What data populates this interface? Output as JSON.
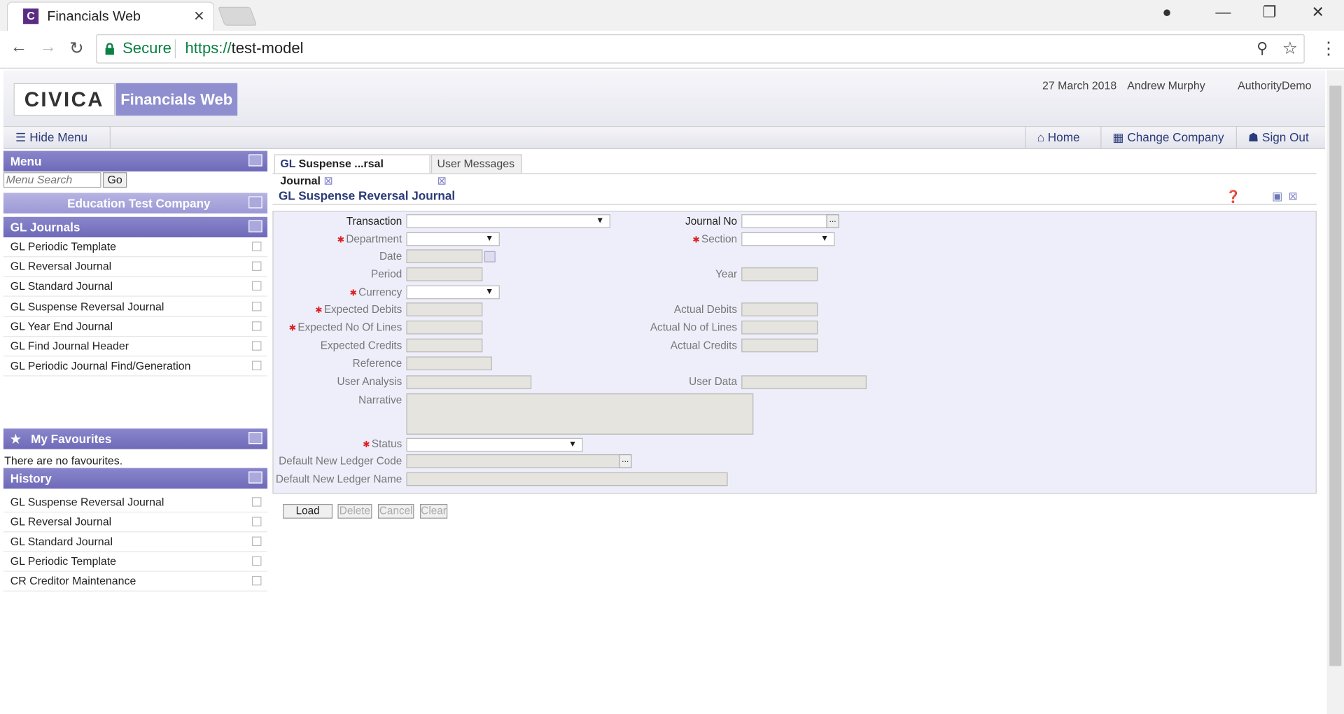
{
  "browser": {
    "tab_title": "Financials Web",
    "secure_label": "Secure",
    "url_scheme": "https://",
    "url_host": "test-model"
  },
  "app": {
    "logo": "CIVICA",
    "product": "Financials Web",
    "date": "27 March 2018",
    "user": "Andrew Murphy",
    "authority": "AuthorityDemo"
  },
  "toolbar": {
    "hide_menu": "Hide Menu",
    "home": "Home",
    "change_company": "Change Company",
    "sign_out": "Sign Out"
  },
  "menu": {
    "title": "Menu",
    "search_placeholder": "Menu Search",
    "go": "Go",
    "company": "Education Test Company",
    "section": "GL Journals",
    "items": [
      "GL Periodic Template",
      "GL Reversal Journal",
      "GL Standard Journal",
      "GL Suspense Reversal Journal",
      "GL Year End Journal",
      "GL Find Journal Header",
      "GL Periodic Journal Find/Generation"
    ]
  },
  "favourites": {
    "title": "My Favourites",
    "empty": "There are no favourites."
  },
  "history": {
    "title": "History",
    "items": [
      "GL Suspense Reversal Journal",
      "GL Reversal Journal",
      "GL Standard Journal",
      "GL Periodic Template",
      "CR Creditor Maintenance"
    ]
  },
  "tabs": {
    "active_prefix": "GL",
    "active_rest": " Suspense ...rsal Journal",
    "inactive": "User Messages"
  },
  "form": {
    "title": "GL Suspense Reversal Journal",
    "labels": {
      "transaction": "Transaction",
      "journal_no": "Journal No",
      "department": "Department",
      "section": "Section",
      "date": "Date",
      "period": "Period",
      "year": "Year",
      "currency": "Currency",
      "expected_debits": "Expected Debits",
      "actual_debits": "Actual Debits",
      "expected_lines": "Expected No Of Lines",
      "actual_lines": "Actual No of Lines",
      "expected_credits": "Expected Credits",
      "actual_credits": "Actual Credits",
      "reference": "Reference",
      "user_analysis": "User Analysis",
      "user_data": "User Data",
      "narrative": "Narrative",
      "status": "Status",
      "default_ledger_code": "Default New Ledger Code",
      "default_ledger_name": "Default New Ledger Name"
    },
    "lookup": "...",
    "dropdown": "▼"
  },
  "buttons": {
    "load": "Load",
    "delete": "Delete",
    "cancel": "Cancel",
    "clear": "Clear"
  }
}
